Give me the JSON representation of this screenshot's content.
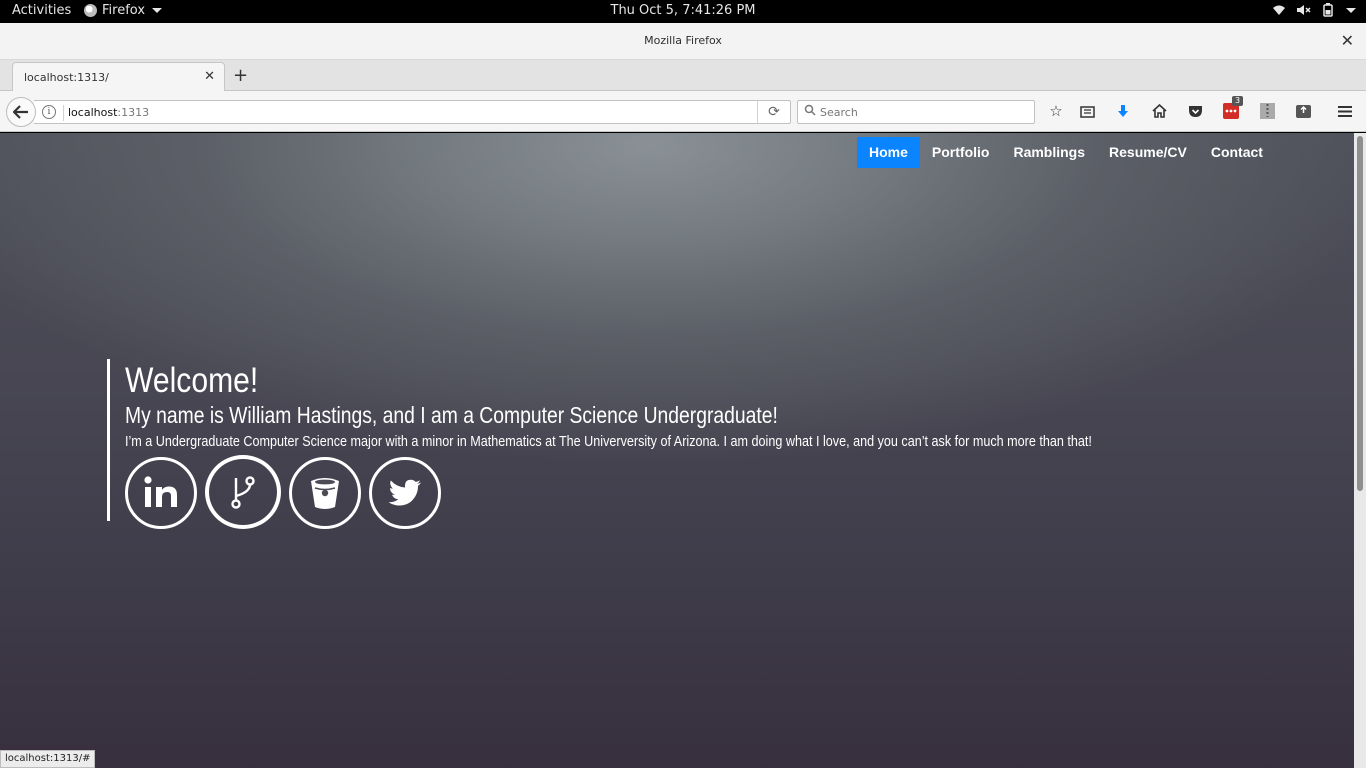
{
  "system": {
    "activities": "Activities",
    "app_name": "Firefox",
    "clock": "Thu Oct  5,  7:41:26 PM"
  },
  "window": {
    "title": "Mozilla Firefox"
  },
  "browser": {
    "tab_title": "localhost:1313/",
    "url_host": "localhost",
    "url_port": ":1313",
    "search_placeholder": "Search",
    "extension_badge": "3",
    "status_url": "localhost:1313/#"
  },
  "site": {
    "nav": [
      "Home",
      "Portfolio",
      "Ramblings",
      "Resume/CV",
      "Contact"
    ],
    "active_nav": "Home",
    "accent": "#0a84ff",
    "hero": {
      "title": "Welcome!",
      "subtitle": "My name is William Hastings, and I am a Computer Science Undergraduate!",
      "body": "I’m a Undergraduate Computer Science major with a minor in Mathematics at The Univerversity of Arizona. I am doing what I love, and you can’t ask for much more than that!"
    },
    "socials": [
      "linkedin-icon",
      "git-branch-icon",
      "bitbucket-icon",
      "twitter-icon"
    ]
  }
}
